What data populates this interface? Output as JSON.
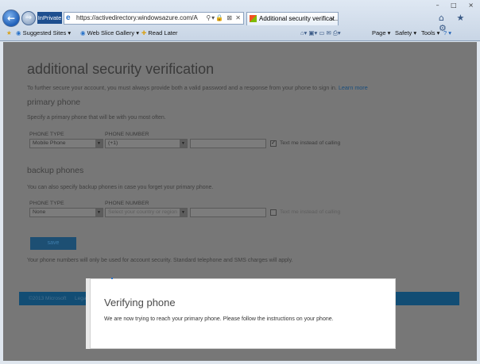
{
  "browser": {
    "inprivate_label": "InPrivate",
    "address_url": "https://activedirectory.windowsazure.com/Additior",
    "tab_title": "Additional security verificat...",
    "tab_close": "×",
    "window_controls": "– □ ×",
    "toolbar_right_icons": "⌂ ★ ⚙",
    "favorites": {
      "suggested_sites": "Suggested Sites ▾",
      "web_slice_gallery": "Web Slice Gallery ▾",
      "read_later": "Read Later"
    },
    "command_bar": {
      "page": "Page ▾",
      "safety": "Safety ▾",
      "tools": "Tools ▾",
      "help": "? ▾"
    }
  },
  "page": {
    "title": "additional security verification",
    "intro": "To further secure your account, you must always provide both a valid password and a response from your phone to sign in.",
    "learn_more": "Learn more",
    "primary": {
      "heading": "primary phone",
      "description": "Specify a primary phone that will be with you most often.",
      "phone_type_label": "PHONE TYPE",
      "phone_number_label": "PHONE NUMBER",
      "phone_type_value": "Mobile Phone",
      "country_code_value": "(+1)",
      "text_me_checked": "✓",
      "text_me_label": "Text me instead of calling"
    },
    "backup": {
      "heading": "backup phones",
      "description": "You can also specify backup phones in case you forget your primary phone.",
      "phone_type_label": "PHONE TYPE",
      "phone_number_label": "PHONE NUMBER",
      "phone_type_value": "None",
      "country_placeholder": "Select your country or region",
      "text_me_label": "Text me instead of calling"
    },
    "save_label": "save",
    "disclaimer": "Your phone numbers will only be used for account security. Standard telephone and SMS charges will apply.",
    "footer": {
      "copyright": "©2013 Microsoft",
      "legal": "Legal"
    }
  },
  "modal": {
    "title": "Verifying phone",
    "message": "We are now trying to reach your primary phone. Please follow the instructions on your phone."
  }
}
